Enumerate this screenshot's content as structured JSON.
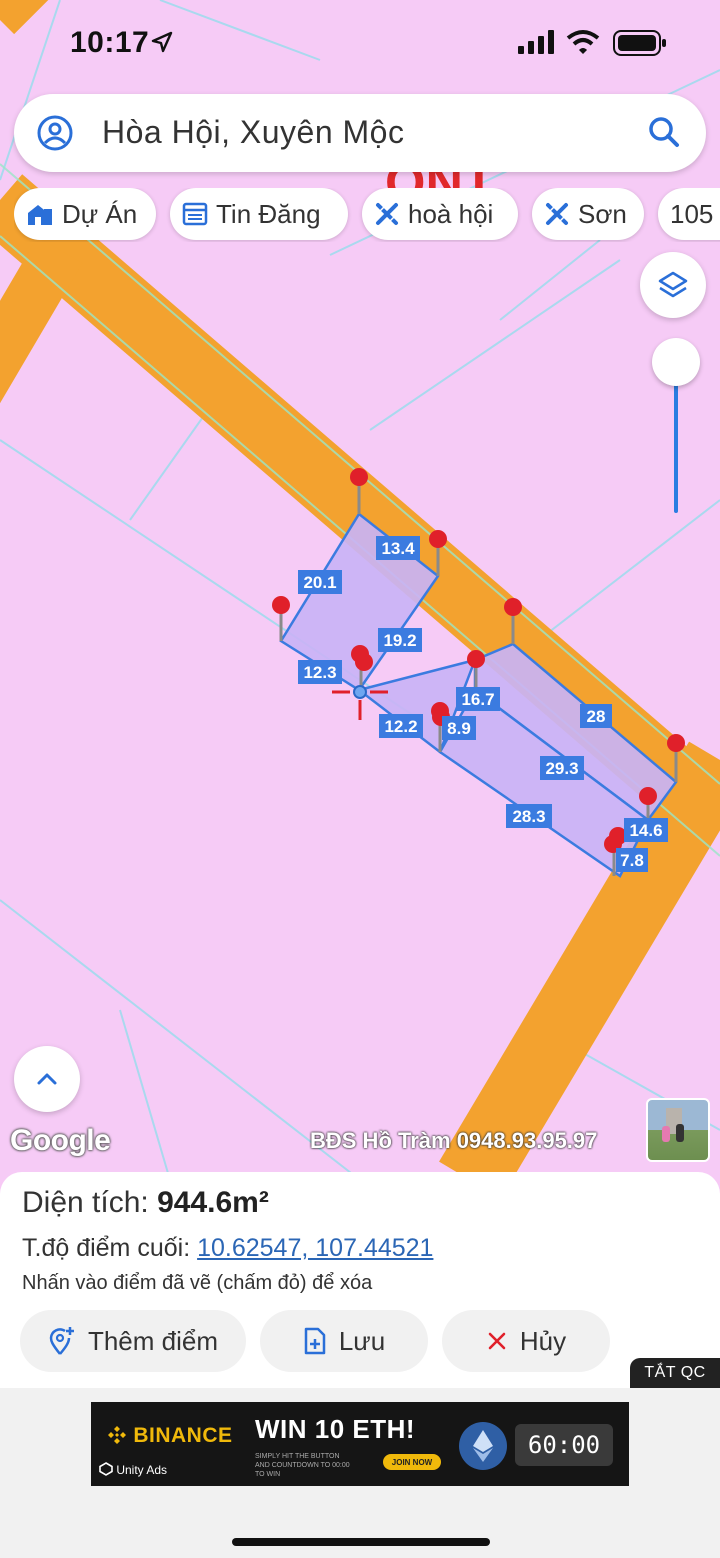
{
  "status_bar": {
    "time": "10:17"
  },
  "search": {
    "text": "Hòa Hội, Xuyên Mộc"
  },
  "chips": [
    {
      "label": "Dự Án"
    },
    {
      "label": "Tin Đăng"
    },
    {
      "label": "hoà hội"
    },
    {
      "label": "Sơn"
    },
    {
      "label": "105"
    }
  ],
  "map": {
    "partial_label": "ONT",
    "edge_labels": [
      "13.4",
      "20.1",
      "19.2",
      "12.3",
      "12.2",
      "8.9",
      "16.7",
      "28",
      "29.3",
      "28.3",
      "14.6",
      "7.8"
    ],
    "google": "Google",
    "watermark": "BĐS Hồ Tràm 0948.93.95.97",
    "colors": {
      "land": "#f6cbf6",
      "road": "#f3a22f",
      "parcel_fill": "#c9b3f5",
      "parcel_stroke": "#3b7be0",
      "pin": "#e0202a"
    }
  },
  "panel": {
    "area_label": "Diện tích:",
    "area_value": "944.6m²",
    "coord_label": "T.độ điểm cuối:",
    "coord_value": "10.62547, 107.44521",
    "hint": "Nhấn vào điểm đã vẽ (chấm đỏ) để xóa",
    "buttons": {
      "add": "Thêm điểm",
      "save": "Lưu",
      "cancel": "Hủy"
    }
  },
  "ad": {
    "close_label": "TẮT QC",
    "brand": "BINANCE",
    "network": "Unity Ads",
    "headline": "WIN 10 ETH!",
    "subtext": "SIMPLY HIT THE BUTTON AND COUNTDOWN TO 00:00 TO WIN",
    "cta": "JOIN NOW",
    "timer": "60:00"
  }
}
